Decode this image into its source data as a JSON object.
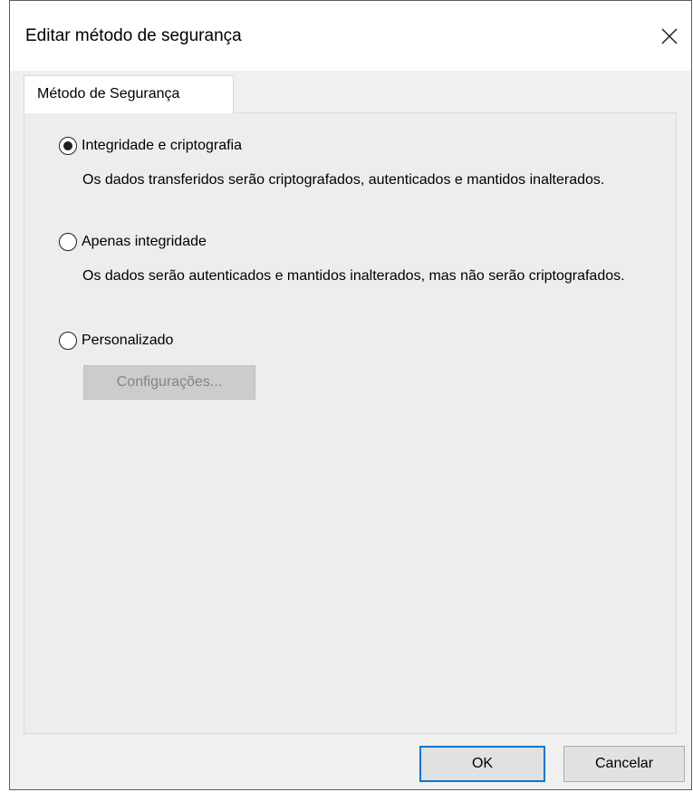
{
  "dialog": {
    "title": "Editar método de segurança",
    "close_icon": "close-icon"
  },
  "tabs": [
    {
      "label": "Método de Segurança",
      "selected": true
    }
  ],
  "options": [
    {
      "label": "Integridade e criptografia",
      "description": "Os dados transferidos serão criptografados, autenticados e mantidos inalterados.",
      "selected": true
    },
    {
      "label": "Apenas integridade",
      "description": "Os dados serão autenticados e mantidos inalterados, mas não serão criptografados.",
      "selected": false
    },
    {
      "label": "Personalizado",
      "selected": false
    }
  ],
  "settings_button": {
    "label": "Configurações...",
    "enabled": false
  },
  "footer": {
    "ok_label": "OK",
    "cancel_label": "Cancelar"
  },
  "colors": {
    "accent": "#0078d7",
    "window_background": "#f0f0f0",
    "disabled_text": "#838383"
  }
}
